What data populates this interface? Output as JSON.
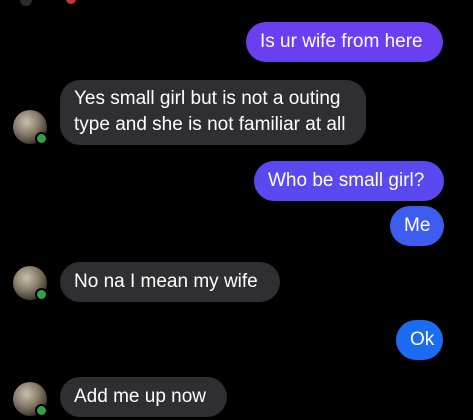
{
  "colors": {
    "background": "#000000",
    "outgoing_purple": "#6a3ff2",
    "outgoing_blue": "#1a6cf0",
    "incoming": "#2f2f33",
    "text": "#ffffff",
    "online": "#31a24c"
  },
  "messages": [
    {
      "direction": "outgoing",
      "text": "Is ur wife from here"
    },
    {
      "direction": "incoming",
      "text": "Yes small girl but is not a outing type and she is not familiar at all"
    },
    {
      "direction": "outgoing",
      "text": "Who be small girl?"
    },
    {
      "direction": "outgoing",
      "text": "Me"
    },
    {
      "direction": "incoming",
      "text": "No na I mean my wife"
    },
    {
      "direction": "outgoing",
      "text": "Ok"
    },
    {
      "direction": "incoming",
      "text": "Add me up now"
    }
  ]
}
